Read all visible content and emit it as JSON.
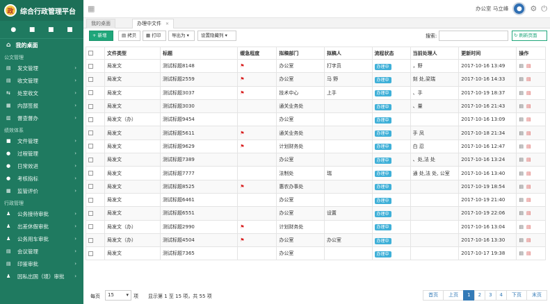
{
  "app": {
    "title": "综合行政管理平台",
    "logo_char": "政"
  },
  "topbar": {
    "user_label": "办公室 马立峰"
  },
  "sidebar": {
    "home": "我的桌面",
    "sections": [
      {
        "title": "公文管理",
        "items": [
          {
            "label": "发文管理",
            "icon": "doc-icon",
            "glyph": "▤"
          },
          {
            "label": "收文管理",
            "icon": "inbox-icon",
            "glyph": "▤"
          },
          {
            "label": "处室收文",
            "icon": "office-icon",
            "glyph": "⇆"
          },
          {
            "label": "内部签报",
            "icon": "report-icon",
            "glyph": "▦"
          },
          {
            "label": "督查督办",
            "icon": "supervise-icon",
            "glyph": "▥"
          }
        ]
      },
      {
        "title": "绩效体系",
        "items": [
          {
            "label": "文件管理",
            "icon": "file-icon",
            "glyph": "■"
          },
          {
            "label": "过程管理",
            "icon": "process-icon",
            "glyph": "●"
          },
          {
            "label": "日常效进",
            "icon": "daily-icon",
            "glyph": "●"
          },
          {
            "label": "考核指标",
            "icon": "kpi-icon",
            "glyph": "●"
          },
          {
            "label": "监管评价",
            "icon": "evaluate-icon",
            "glyph": "▦"
          }
        ]
      },
      {
        "title": "行政管理",
        "items": [
          {
            "label": "公务接待审批",
            "icon": "reception-icon",
            "glyph": "♟"
          },
          {
            "label": "出差休假审批",
            "icon": "travel-icon",
            "glyph": "♟"
          },
          {
            "label": "公务用车审批",
            "icon": "car-icon",
            "glyph": "♟"
          },
          {
            "label": "会议管理",
            "icon": "meeting-icon",
            "glyph": "▤"
          },
          {
            "label": "印鉴审批",
            "icon": "seal-icon",
            "glyph": "▤"
          },
          {
            "label": "因私出国（境）审批",
            "icon": "abroad-icon",
            "glyph": "♟"
          }
        ]
      }
    ]
  },
  "tabs": [
    {
      "label": "我的桌面",
      "closable": false
    },
    {
      "label": "办理中文件",
      "closable": true
    }
  ],
  "toolbar": {
    "new": "+ 新增",
    "copy": "拷贝",
    "print": "打印",
    "export": "导出为 ▾",
    "columns": "设置隐藏列 ▾",
    "search_label": "搜索:",
    "search_value": "",
    "refresh": "刷新页面"
  },
  "table": {
    "headers": [
      "",
      "文件类型",
      "标题",
      "缓急程度",
      "拟稿部门",
      "拟稿人",
      "流程状态",
      "当前处理人",
      "更新时间",
      "操作"
    ],
    "rows": [
      {
        "type": "局发文",
        "title": "测试标题8148",
        "urgent": true,
        "dept": "办公室",
        "author": "打字员",
        "status": "办理中",
        "handler": "，野",
        "time": "2017-10-16 13:49"
      },
      {
        "type": "局发文",
        "title": "测试标题2559",
        "urgent": true,
        "dept": "办公室",
        "author": "马   野",
        "status": "办理中",
        "handler": "刻  处,梁瑞",
        "time": "2017-10-16 14:33"
      },
      {
        "type": "局发文",
        "title": "测试标题3037",
        "urgent": true,
        "dept": "技术中心",
        "author": "   上手",
        "status": "办理中",
        "handler": "、手",
        "time": "2017-10-19 18:37"
      },
      {
        "type": "局发文",
        "title": "测试标题3030",
        "urgent": false,
        "dept": "通关业务处",
        "author": "",
        "status": "办理中",
        "handler": "、量",
        "time": "2017-10-16 21:43"
      },
      {
        "type": "局发文（办）",
        "title": "测试标题9454",
        "urgent": false,
        "dept": "办公室",
        "author": "",
        "status": "办理中",
        "handler": "",
        "time": "2017-10-16 13:09"
      },
      {
        "type": "局发文",
        "title": "测试标题5611",
        "urgent": true,
        "dept": "通关业务处",
        "author": "",
        "status": "办理中",
        "handler": "手   凤",
        "time": "2017-10-18 21:34"
      },
      {
        "type": "局发文",
        "title": "测试标题9629",
        "urgent": true,
        "dept": "计划财务处",
        "author": "",
        "status": "办理中",
        "handler": "白   忍",
        "time": "2017-10-16 12:47"
      },
      {
        "type": "局发文",
        "title": "测试标题7389",
        "urgent": false,
        "dept": "办公室",
        "author": "",
        "status": "办理中",
        "handler": "、处,法  处",
        "time": "2017-10-16 13:24"
      },
      {
        "type": "局发文",
        "title": "测试标题7777",
        "urgent": false,
        "dept": "法制处",
        "author": "   瑞",
        "status": "办理中",
        "handler": "通  处,法  处,  公室",
        "time": "2017-10-16 13:40"
      },
      {
        "type": "局发文",
        "title": "测试标题8525",
        "urgent": true,
        "dept": "惠农办事处",
        "author": "",
        "status": "办理中",
        "handler": "",
        "time": "2017-10-19 18:54"
      },
      {
        "type": "局发文",
        "title": "测试标题6461",
        "urgent": false,
        "dept": "办公室",
        "author": "",
        "status": "办理中",
        "handler": "",
        "time": "2017-10-19 21:40"
      },
      {
        "type": "局发文",
        "title": "测试标题6551",
        "urgent": false,
        "dept": "办公室",
        "author": "   设置",
        "status": "办理中",
        "handler": "",
        "time": "2017-10-19 22:06"
      },
      {
        "type": "局发文（办）",
        "title": "测试标题2990",
        "urgent": true,
        "dept": "计划财务处",
        "author": "",
        "status": "办理中",
        "handler": "",
        "time": "2017-10-16 13:04"
      },
      {
        "type": "局发文（办）",
        "title": "测试标题4504",
        "urgent": true,
        "dept": "办公室",
        "author": "办公室",
        "status": "办理中",
        "handler": "",
        "time": "2017-10-16 13:30"
      },
      {
        "type": "局发文",
        "title": "测试标题7365",
        "urgent": false,
        "dept": "办公室",
        "author": "",
        "status": "办理中",
        "handler": "",
        "time": "2017-10-17 19:38"
      }
    ]
  },
  "footer": {
    "per_page_label": "每页",
    "per_page_value": "15",
    "per_page_unit": "项",
    "info": "显示第 1 至 15 项，共 55 项",
    "pager": [
      "首页",
      "上页",
      "1",
      "2",
      "3",
      "4",
      "下页",
      "末页"
    ],
    "current_page": "1"
  }
}
